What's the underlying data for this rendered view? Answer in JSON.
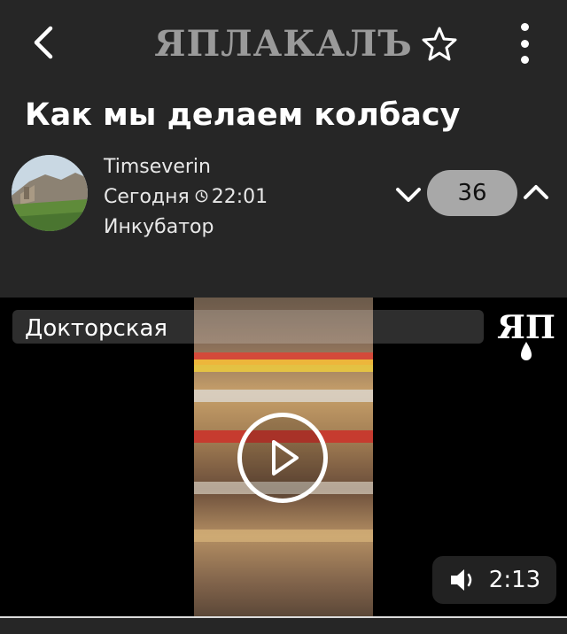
{
  "header": {
    "logo_text": "ЯПЛАКАЛЪ",
    "back_icon": "chevron-left-icon",
    "favorite_icon": "star-icon",
    "menu_icon": "more-vertical-icon"
  },
  "post": {
    "title": "Как мы делаем колбасу",
    "author": "Timseverin",
    "date_label": "Сегодня",
    "time": "22:01",
    "section": "Инкубатор",
    "rating": "36"
  },
  "video": {
    "caption": "Докторская",
    "watermark": "ЯП",
    "duration": "2:13"
  },
  "colors": {
    "background": "#262626",
    "rating_pill": "#a8a8a8",
    "logo": "#9a9a9a"
  }
}
